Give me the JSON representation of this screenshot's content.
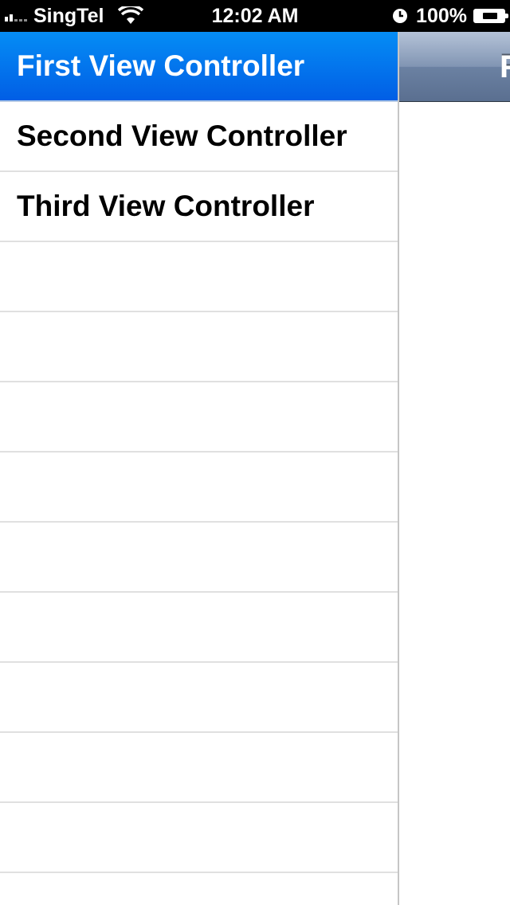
{
  "status_bar": {
    "carrier": "SingTel",
    "time": "12:02 AM",
    "battery_percent": "100%",
    "signal_bars_total": 5,
    "signal_bars_filled": 2,
    "icons": [
      "signal-icon",
      "wifi-icon",
      "alarm-icon",
      "battery-charging-icon"
    ]
  },
  "menu": {
    "items": [
      {
        "label": "First View Controller",
        "selected": true
      },
      {
        "label": "Second View Controller",
        "selected": false
      },
      {
        "label": "Third View Controller",
        "selected": false
      }
    ],
    "empty_rows": 10,
    "colors": {
      "selected_background": "#0377ec",
      "selected_text": "#ffffff",
      "separator": "#e0e0e0"
    }
  },
  "front_view": {
    "nav_title": "F",
    "colors": {
      "nav_bar": "#6b81a2"
    }
  }
}
